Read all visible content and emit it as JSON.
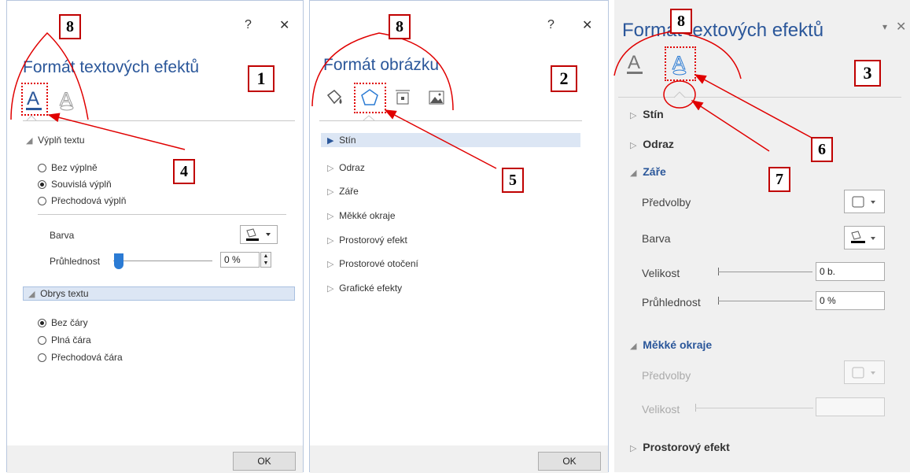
{
  "panel1": {
    "title": "Formát textových efektů",
    "help": "?",
    "close": "✕",
    "badge": "1",
    "sections": {
      "fill": "Výplň textu",
      "outline": "Obrys textu"
    },
    "fill_options": [
      "Bez výplně",
      "Souvislá výplň",
      "Přechodová výplň"
    ],
    "fill_selected": 1,
    "color_label": "Barva",
    "transparency_label": "Průhlednost",
    "transparency_value": "0 %",
    "outline_options": [
      "Bez čáry",
      "Plná čára",
      "Přechodová čára"
    ],
    "outline_selected": 0,
    "ok": "OK"
  },
  "panel2": {
    "title": "Formát obrázku",
    "help": "?",
    "close": "✕",
    "badge": "2",
    "items": [
      "Stín",
      "Odraz",
      "Záře",
      "Měkké okraje",
      "Prostorový efekt",
      "Prostorové otočení",
      "Grafické efekty"
    ],
    "selected": 0,
    "ok": "OK"
  },
  "panel3": {
    "title": "Formát textových efektů",
    "badge": "3",
    "sections": [
      "Stín",
      "Odraz",
      "Záře",
      "Měkké okraje",
      "Prostorový efekt"
    ],
    "glow": {
      "presets_label": "Předvolby",
      "color_label": "Barva",
      "size_label": "Velikost",
      "size_value": "0 b.",
      "transparency_label": "Průhlednost",
      "transparency_value": "0 %"
    },
    "soft": {
      "presets_label": "Předvolby",
      "size_label": "Velikost"
    }
  },
  "annotations": {
    "n4": "4",
    "n5": "5",
    "n6": "6",
    "n7": "7",
    "n8a": "8",
    "n8b": "8",
    "n8c": "8"
  },
  "colors": {
    "accent": "#2b579a",
    "annotation": "#e00000"
  }
}
